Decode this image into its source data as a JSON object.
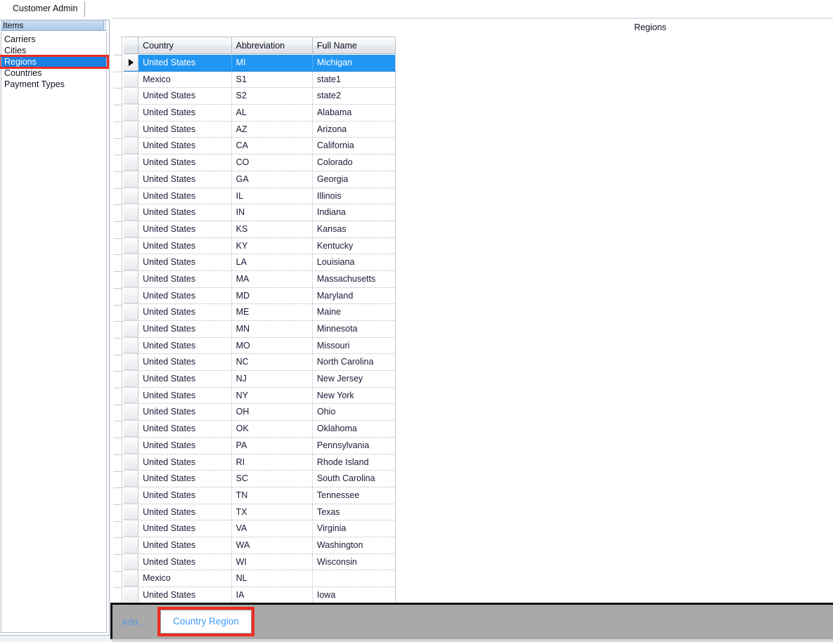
{
  "window": {
    "tab_label": "Customer Admin"
  },
  "sidebar": {
    "header": "Items",
    "items": [
      {
        "label": "Carriers",
        "selected": false
      },
      {
        "label": "Cities",
        "selected": false
      },
      {
        "label": "Regions",
        "selected": true
      },
      {
        "label": "Countries",
        "selected": false
      },
      {
        "label": "Payment Types",
        "selected": false
      }
    ]
  },
  "main": {
    "title": "Regions"
  },
  "grid": {
    "columns": [
      "Country",
      "Abbreviation",
      "Full Name"
    ],
    "rows": [
      {
        "country": "United States",
        "abbreviation": "MI",
        "full_name": "Michigan",
        "selected": true
      },
      {
        "country": "Mexico",
        "abbreviation": "S1",
        "full_name": "state1",
        "selected": false
      },
      {
        "country": "United States",
        "abbreviation": "S2",
        "full_name": "state2",
        "selected": false
      },
      {
        "country": "United States",
        "abbreviation": "AL",
        "full_name": "Alabama",
        "selected": false
      },
      {
        "country": "United States",
        "abbreviation": "AZ",
        "full_name": "Arizona",
        "selected": false
      },
      {
        "country": "United States",
        "abbreviation": "CA",
        "full_name": "California",
        "selected": false
      },
      {
        "country": "United States",
        "abbreviation": "CO",
        "full_name": "Colorado",
        "selected": false
      },
      {
        "country": "United States",
        "abbreviation": "GA",
        "full_name": "Georgia",
        "selected": false
      },
      {
        "country": "United States",
        "abbreviation": "IL",
        "full_name": "Illinois",
        "selected": false
      },
      {
        "country": "United States",
        "abbreviation": "IN",
        "full_name": "Indiana",
        "selected": false
      },
      {
        "country": "United States",
        "abbreviation": "KS",
        "full_name": "Kansas",
        "selected": false
      },
      {
        "country": "United States",
        "abbreviation": "KY",
        "full_name": "Kentucky",
        "selected": false
      },
      {
        "country": "United States",
        "abbreviation": "LA",
        "full_name": "Louisiana",
        "selected": false
      },
      {
        "country": "United States",
        "abbreviation": "MA",
        "full_name": "Massachusetts",
        "selected": false
      },
      {
        "country": "United States",
        "abbreviation": "MD",
        "full_name": "Maryland",
        "selected": false
      },
      {
        "country": "United States",
        "abbreviation": "ME",
        "full_name": "Maine",
        "selected": false
      },
      {
        "country": "United States",
        "abbreviation": "MN",
        "full_name": "Minnesota",
        "selected": false
      },
      {
        "country": "United States",
        "abbreviation": "MO",
        "full_name": "Missouri",
        "selected": false
      },
      {
        "country": "United States",
        "abbreviation": "NC",
        "full_name": "North Carolina",
        "selected": false
      },
      {
        "country": "United States",
        "abbreviation": "NJ",
        "full_name": "New Jersey",
        "selected": false
      },
      {
        "country": "United States",
        "abbreviation": "NY",
        "full_name": "New York",
        "selected": false
      },
      {
        "country": "United States",
        "abbreviation": "OH",
        "full_name": "Ohio",
        "selected": false
      },
      {
        "country": "United States",
        "abbreviation": "OK",
        "full_name": "Oklahoma",
        "selected": false
      },
      {
        "country": "United States",
        "abbreviation": "PA",
        "full_name": "Pennsylvania",
        "selected": false
      },
      {
        "country": "United States",
        "abbreviation": "RI",
        "full_name": "Rhode Island",
        "selected": false
      },
      {
        "country": "United States",
        "abbreviation": "SC",
        "full_name": "South Carolina",
        "selected": false
      },
      {
        "country": "United States",
        "abbreviation": "TN",
        "full_name": "Tennessee",
        "selected": false
      },
      {
        "country": "United States",
        "abbreviation": "TX",
        "full_name": "Texas",
        "selected": false
      },
      {
        "country": "United States",
        "abbreviation": "VA",
        "full_name": "Virginia",
        "selected": false
      },
      {
        "country": "United States",
        "abbreviation": "WA",
        "full_name": "Washington",
        "selected": false
      },
      {
        "country": "United States",
        "abbreviation": "WI",
        "full_name": "Wisconsin",
        "selected": false
      },
      {
        "country": "Mexico",
        "abbreviation": "NL",
        "full_name": "",
        "selected": false
      },
      {
        "country": "United States",
        "abbreviation": "IA",
        "full_name": "Iowa",
        "selected": false
      }
    ]
  },
  "bottom_bar": {
    "add_label": "Add ...",
    "country_region_label": "Country Region"
  },
  "colors": {
    "selection_blue": "#2196f3",
    "sidebar_selection_blue": "#1a7fe0",
    "highlight_red": "#ee2d23",
    "bottom_bar_gray": "#a9a9a9",
    "link_blue": "#3d9bf5",
    "muted_link_blue": "#5f9ae0"
  }
}
